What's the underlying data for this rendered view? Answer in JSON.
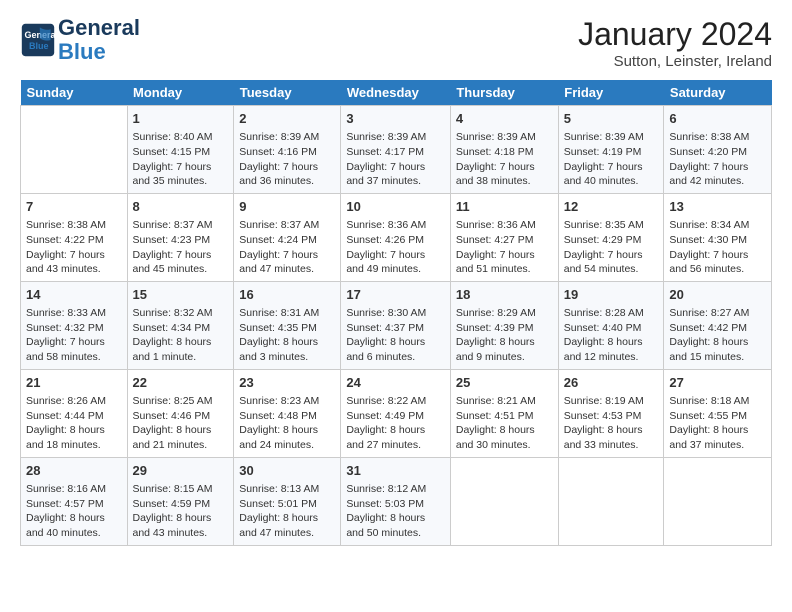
{
  "logo": {
    "line1": "General",
    "line2": "Blue"
  },
  "header": {
    "month": "January 2024",
    "location": "Sutton, Leinster, Ireland"
  },
  "days_of_week": [
    "Sunday",
    "Monday",
    "Tuesday",
    "Wednesday",
    "Thursday",
    "Friday",
    "Saturday"
  ],
  "weeks": [
    [
      {
        "day": "",
        "info": ""
      },
      {
        "day": "1",
        "info": "Sunrise: 8:40 AM\nSunset: 4:15 PM\nDaylight: 7 hours\nand 35 minutes."
      },
      {
        "day": "2",
        "info": "Sunrise: 8:39 AM\nSunset: 4:16 PM\nDaylight: 7 hours\nand 36 minutes."
      },
      {
        "day": "3",
        "info": "Sunrise: 8:39 AM\nSunset: 4:17 PM\nDaylight: 7 hours\nand 37 minutes."
      },
      {
        "day": "4",
        "info": "Sunrise: 8:39 AM\nSunset: 4:18 PM\nDaylight: 7 hours\nand 38 minutes."
      },
      {
        "day": "5",
        "info": "Sunrise: 8:39 AM\nSunset: 4:19 PM\nDaylight: 7 hours\nand 40 minutes."
      },
      {
        "day": "6",
        "info": "Sunrise: 8:38 AM\nSunset: 4:20 PM\nDaylight: 7 hours\nand 42 minutes."
      }
    ],
    [
      {
        "day": "7",
        "info": "Sunrise: 8:38 AM\nSunset: 4:22 PM\nDaylight: 7 hours\nand 43 minutes."
      },
      {
        "day": "8",
        "info": "Sunrise: 8:37 AM\nSunset: 4:23 PM\nDaylight: 7 hours\nand 45 minutes."
      },
      {
        "day": "9",
        "info": "Sunrise: 8:37 AM\nSunset: 4:24 PM\nDaylight: 7 hours\nand 47 minutes."
      },
      {
        "day": "10",
        "info": "Sunrise: 8:36 AM\nSunset: 4:26 PM\nDaylight: 7 hours\nand 49 minutes."
      },
      {
        "day": "11",
        "info": "Sunrise: 8:36 AM\nSunset: 4:27 PM\nDaylight: 7 hours\nand 51 minutes."
      },
      {
        "day": "12",
        "info": "Sunrise: 8:35 AM\nSunset: 4:29 PM\nDaylight: 7 hours\nand 54 minutes."
      },
      {
        "day": "13",
        "info": "Sunrise: 8:34 AM\nSunset: 4:30 PM\nDaylight: 7 hours\nand 56 minutes."
      }
    ],
    [
      {
        "day": "14",
        "info": "Sunrise: 8:33 AM\nSunset: 4:32 PM\nDaylight: 7 hours\nand 58 minutes."
      },
      {
        "day": "15",
        "info": "Sunrise: 8:32 AM\nSunset: 4:34 PM\nDaylight: 8 hours\nand 1 minute."
      },
      {
        "day": "16",
        "info": "Sunrise: 8:31 AM\nSunset: 4:35 PM\nDaylight: 8 hours\nand 3 minutes."
      },
      {
        "day": "17",
        "info": "Sunrise: 8:30 AM\nSunset: 4:37 PM\nDaylight: 8 hours\nand 6 minutes."
      },
      {
        "day": "18",
        "info": "Sunrise: 8:29 AM\nSunset: 4:39 PM\nDaylight: 8 hours\nand 9 minutes."
      },
      {
        "day": "19",
        "info": "Sunrise: 8:28 AM\nSunset: 4:40 PM\nDaylight: 8 hours\nand 12 minutes."
      },
      {
        "day": "20",
        "info": "Sunrise: 8:27 AM\nSunset: 4:42 PM\nDaylight: 8 hours\nand 15 minutes."
      }
    ],
    [
      {
        "day": "21",
        "info": "Sunrise: 8:26 AM\nSunset: 4:44 PM\nDaylight: 8 hours\nand 18 minutes."
      },
      {
        "day": "22",
        "info": "Sunrise: 8:25 AM\nSunset: 4:46 PM\nDaylight: 8 hours\nand 21 minutes."
      },
      {
        "day": "23",
        "info": "Sunrise: 8:23 AM\nSunset: 4:48 PM\nDaylight: 8 hours\nand 24 minutes."
      },
      {
        "day": "24",
        "info": "Sunrise: 8:22 AM\nSunset: 4:49 PM\nDaylight: 8 hours\nand 27 minutes."
      },
      {
        "day": "25",
        "info": "Sunrise: 8:21 AM\nSunset: 4:51 PM\nDaylight: 8 hours\nand 30 minutes."
      },
      {
        "day": "26",
        "info": "Sunrise: 8:19 AM\nSunset: 4:53 PM\nDaylight: 8 hours\nand 33 minutes."
      },
      {
        "day": "27",
        "info": "Sunrise: 8:18 AM\nSunset: 4:55 PM\nDaylight: 8 hours\nand 37 minutes."
      }
    ],
    [
      {
        "day": "28",
        "info": "Sunrise: 8:16 AM\nSunset: 4:57 PM\nDaylight: 8 hours\nand 40 minutes."
      },
      {
        "day": "29",
        "info": "Sunrise: 8:15 AM\nSunset: 4:59 PM\nDaylight: 8 hours\nand 43 minutes."
      },
      {
        "day": "30",
        "info": "Sunrise: 8:13 AM\nSunset: 5:01 PM\nDaylight: 8 hours\nand 47 minutes."
      },
      {
        "day": "31",
        "info": "Sunrise: 8:12 AM\nSunset: 5:03 PM\nDaylight: 8 hours\nand 50 minutes."
      },
      {
        "day": "",
        "info": ""
      },
      {
        "day": "",
        "info": ""
      },
      {
        "day": "",
        "info": ""
      }
    ]
  ]
}
